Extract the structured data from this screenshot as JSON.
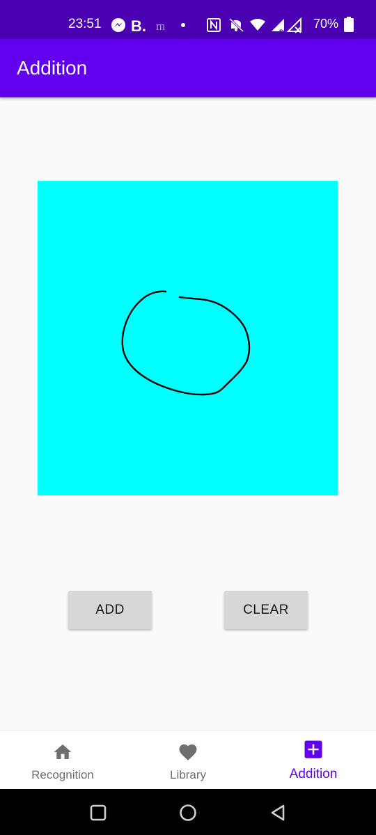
{
  "status_bar": {
    "time": "23:51",
    "battery": "70%",
    "icons": [
      "messenger-icon",
      "b-app-icon",
      "m-app-icon",
      "dot-icon",
      "nfc-icon",
      "bell-off-icon",
      "wifi-icon",
      "signal-r-icon",
      "signal-x-icon",
      "battery-icon"
    ],
    "icon_glyphs": {
      "b": "B.",
      "m": "m"
    },
    "background": "#4a00b0"
  },
  "app_bar": {
    "title": "Addition",
    "background": "#6200ee"
  },
  "canvas": {
    "background": "#00ffff",
    "stroke_color": "#000000"
  },
  "buttons": {
    "add_label": "ADD",
    "clear_label": "CLEAR"
  },
  "bottom_nav": {
    "items": [
      {
        "label": "Recognition",
        "icon": "home-icon",
        "active": false
      },
      {
        "label": "Library",
        "icon": "heart-icon",
        "active": false
      },
      {
        "label": "Addition",
        "icon": "add-box-icon",
        "active": true
      }
    ],
    "active_color": "#6200ee",
    "inactive_color": "#6e6e6e"
  },
  "system_nav": {
    "buttons": [
      "recents-square-icon",
      "home-circle-icon",
      "back-triangle-icon"
    ]
  }
}
